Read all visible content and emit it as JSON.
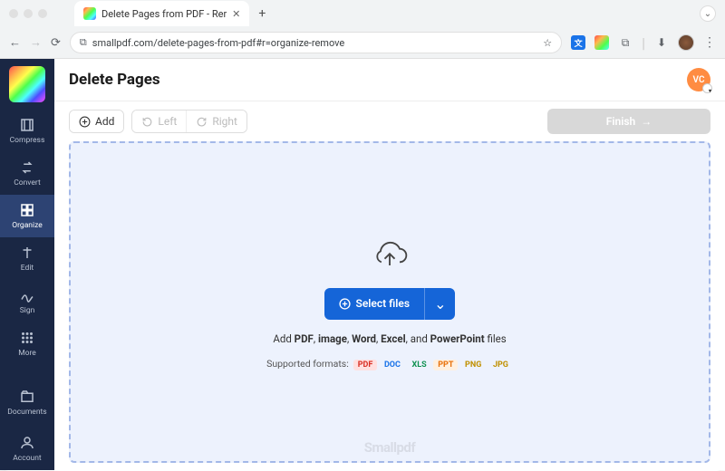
{
  "browser": {
    "tab_title": "Delete Pages from PDF - Rer",
    "url": "smallpdf.com/delete-pages-from-pdf#r=organize-remove"
  },
  "sidebar": {
    "items": [
      {
        "label": "Compress",
        "icon": "compress"
      },
      {
        "label": "Convert",
        "icon": "convert"
      },
      {
        "label": "Organize",
        "icon": "organize",
        "active": true
      },
      {
        "label": "Edit",
        "icon": "edit"
      },
      {
        "label": "Sign",
        "icon": "sign"
      },
      {
        "label": "More",
        "icon": "more"
      }
    ],
    "documents_label": "Documents",
    "account_label": "Account"
  },
  "header": {
    "title": "Delete Pages",
    "user_initials": "VC"
  },
  "toolbar": {
    "add_label": "Add",
    "left_label": "Left",
    "right_label": "Right",
    "finish_label": "Finish"
  },
  "dropzone": {
    "select_label": "Select files",
    "desc_prefix": "Add ",
    "desc_types": [
      "PDF",
      "image",
      "Word",
      "Excel",
      "PowerPoint"
    ],
    "desc_separator": ", ",
    "desc_and": ", and ",
    "desc_suffix": " files",
    "formats_label": "Supported formats:",
    "formats": [
      {
        "code": "PDF",
        "class": "pdf"
      },
      {
        "code": "DOC",
        "class": "doc"
      },
      {
        "code": "XLS",
        "class": "xls"
      },
      {
        "code": "PPT",
        "class": "ppt"
      },
      {
        "code": "PNG",
        "class": "png"
      },
      {
        "code": "JPG",
        "class": "jpg"
      }
    ],
    "watermark": "Smallpdf"
  }
}
